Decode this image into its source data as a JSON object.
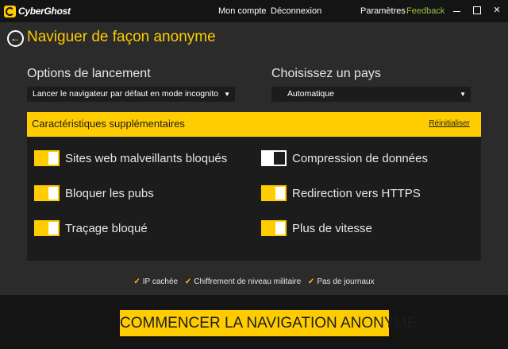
{
  "app": {
    "brand": "CyberGhost"
  },
  "topbar": {
    "account": "Mon compte",
    "logout": "Déconnexion",
    "settings": "Paramètres",
    "feedback": "Feedback"
  },
  "colors": {
    "accent": "#ffcc00",
    "feedback": "#9bc43b",
    "background": "#2b2b2b",
    "panel": "#1c1c1c",
    "bar": "#141414"
  },
  "icons": {
    "back": "arrow-left-icon",
    "logo": "cyberghost-logo-icon",
    "check": "check-icon",
    "caret": "caret-down-icon"
  },
  "page": {
    "title": "Naviguer de façon anonyme"
  },
  "launch": {
    "label": "Options de lancement",
    "selected": "Lancer le navigateur par défaut en mode incognito"
  },
  "country": {
    "label": "Choisissez un pays",
    "selected": "Automatique"
  },
  "features_panel": {
    "title": "Caractéristiques supplémentaires",
    "reset": "Réinitialiser",
    "options": [
      {
        "label": "Sites web malveillants bloqués",
        "on": true
      },
      {
        "label": "Compression de données",
        "on": false
      },
      {
        "label": "Bloquer les pubs",
        "on": true
      },
      {
        "label": "Redirection vers HTTPS",
        "on": true
      },
      {
        "label": "Traçage bloqué",
        "on": true
      },
      {
        "label": "Plus de vitesse",
        "on": true
      }
    ]
  },
  "benefits": [
    "IP cachée",
    "Chiffrement de niveau militaire",
    "Pas de journaux"
  ],
  "cta": {
    "label": "COMMENCER LA NAVIGATION ANONYME"
  }
}
